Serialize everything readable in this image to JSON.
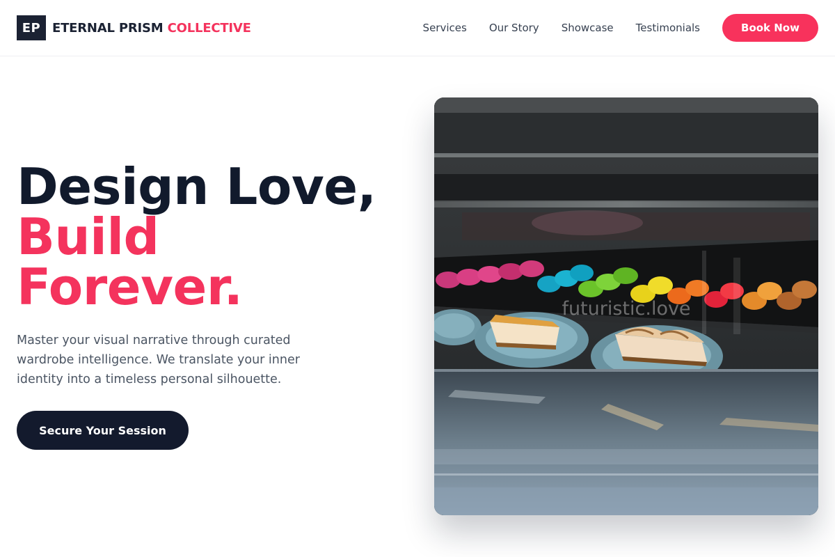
{
  "brand": {
    "logo_mark": "EP",
    "name_primary": "ETERNAL PRISM",
    "name_accent": "COLLECTIVE"
  },
  "nav": {
    "links": [
      "Services",
      "Our Story",
      "Showcase",
      "Testimonials"
    ],
    "cta_label": "Book Now"
  },
  "hero": {
    "title_line1": "Design Love,",
    "title_line2": "Build",
    "title_line3": "Forever.",
    "description": "Master your visual narrative through curated wardrobe intelligence. We translate your inner identity into a timeless personal silhouette.",
    "cta_label": "Secure Your Session"
  },
  "image": {
    "watermark": "futuristic.love"
  },
  "colors": {
    "accent": "#f4335d",
    "dark": "#131a2d",
    "body_text": "#4b5563"
  }
}
